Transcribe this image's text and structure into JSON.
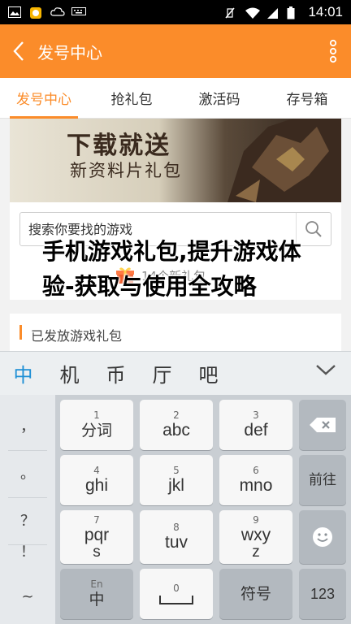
{
  "status_bar": {
    "time": "14:01"
  },
  "app_bar": {
    "title": "发号中心"
  },
  "tabs": [
    {
      "label": "发号中心",
      "active": true
    },
    {
      "label": "抢礼包",
      "active": false
    },
    {
      "label": "激活码",
      "active": false
    },
    {
      "label": "存号箱",
      "active": false
    }
  ],
  "banner": {
    "title": "下载就送",
    "subtitle": "新资料片礼包"
  },
  "search": {
    "placeholder": "搜索你要找的游戏"
  },
  "gift_count": {
    "text": "14个新礼包"
  },
  "section": {
    "title": "已发放游戏礼包"
  },
  "overlay": {
    "title": "手机游戏礼包,提升游戏体验-获取与使用全攻略"
  },
  "candidates": [
    "中",
    "机",
    "币",
    "厅",
    "吧"
  ],
  "keyboard": {
    "punctuation": [
      "，",
      "。",
      "？",
      "！",
      "~"
    ],
    "keys": [
      {
        "num": "1",
        "main": "分词",
        "sub": ""
      },
      {
        "num": "2",
        "main": "abc",
        "sub": ""
      },
      {
        "num": "3",
        "main": "def",
        "sub": ""
      },
      {
        "num": "4",
        "main": "ghi",
        "sub": ""
      },
      {
        "num": "5",
        "main": "jkl",
        "sub": ""
      },
      {
        "num": "6",
        "main": "mno",
        "sub": ""
      },
      {
        "num": "7",
        "main": "pqr",
        "sub": "s"
      },
      {
        "num": "8",
        "main": "tuv",
        "sub": ""
      },
      {
        "num": "9",
        "main": "wxy",
        "sub": "z"
      }
    ],
    "bottom": {
      "lang_small": "En",
      "lang_main": "中",
      "space_num": "0",
      "symbols": "符号",
      "numbers": "123"
    },
    "right": {
      "prev": "前往"
    }
  },
  "colors": {
    "accent": "#fb8c2a",
    "candidate_active": "#1e8fd5"
  }
}
